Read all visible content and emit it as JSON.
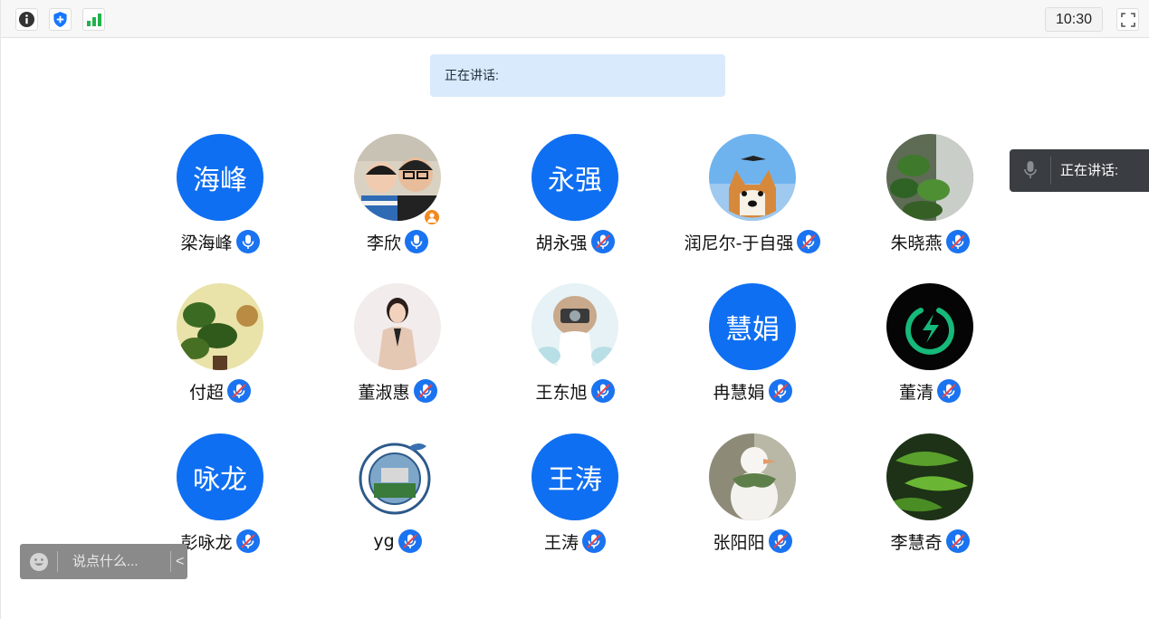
{
  "toolbar": {
    "info_icon": "info-icon",
    "shield_icon": "shield-icon",
    "signal_icon": "signal-icon",
    "time": "10:30",
    "fullscreen_icon": "fullscreen-icon"
  },
  "speaking_banner": {
    "label": "正在讲话:"
  },
  "speaking_panel": {
    "label": "正在讲话:",
    "icon": "mic-icon"
  },
  "chat": {
    "placeholder": "说点什么...",
    "collapse": "<"
  },
  "colors": {
    "accent": "#0f6ff2",
    "banner_bg": "#d9eafc",
    "panel_bg": "#3a3d42",
    "host_badge": "#f28a1e"
  },
  "participants": [
    {
      "name": "梁海峰",
      "avatar_text": "海峰",
      "mic": "active"
    },
    {
      "name": "李欣",
      "avatar_image": "family-photo",
      "mic": "active",
      "host": true
    },
    {
      "name": "胡永强",
      "avatar_text": "永强",
      "mic": "muted"
    },
    {
      "name": "润尼尔-于自强",
      "avatar_image": "shiba-dog-photo",
      "mic": "muted"
    },
    {
      "name": "朱晓燕",
      "avatar_image": "plants-photo",
      "mic": "muted"
    },
    {
      "name": "付超",
      "avatar_image": "potted-plant-photo",
      "mic": "muted"
    },
    {
      "name": "董淑惠",
      "avatar_image": "woman-portrait-photo",
      "mic": "muted"
    },
    {
      "name": "王东旭",
      "avatar_image": "anime-girl-camera",
      "mic": "muted"
    },
    {
      "name": "冉慧娟",
      "avatar_text": "慧娟",
      "mic": "muted"
    },
    {
      "name": "董清",
      "avatar_image": "green-power-logo",
      "mic": "muted"
    },
    {
      "name": "彭咏龙",
      "avatar_text": "咏龙",
      "mic": "muted"
    },
    {
      "name": "yg",
      "avatar_image": "university-seal",
      "mic": "muted"
    },
    {
      "name": "王涛",
      "avatar_text": "王涛",
      "mic": "muted"
    },
    {
      "name": "张阳阳",
      "avatar_image": "duck-figurine-photo",
      "mic": "muted"
    },
    {
      "name": "李慧奇",
      "avatar_image": "green-leaves-photo",
      "mic": "muted"
    }
  ]
}
